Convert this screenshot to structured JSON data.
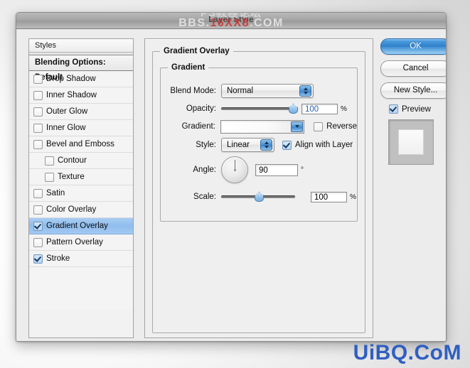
{
  "window": {
    "title": "Layer Style"
  },
  "watermarks": {
    "top_line1": "PS教程论坛",
    "top_line2_prefix": "BBS.",
    "top_line2_red": "16XX8",
    "top_line2_suffix": ".COM",
    "bottom": "UiBQ.CoM",
    "bottom_color": "#2f5fc0"
  },
  "styles_panel": {
    "header": "Styles",
    "blending_options": "Blending Options: Default",
    "items": [
      {
        "label": "Drop Shadow",
        "checked": false,
        "indent": false,
        "selected": false
      },
      {
        "label": "Inner Shadow",
        "checked": false,
        "indent": false,
        "selected": false
      },
      {
        "label": "Outer Glow",
        "checked": false,
        "indent": false,
        "selected": false
      },
      {
        "label": "Inner Glow",
        "checked": false,
        "indent": false,
        "selected": false
      },
      {
        "label": "Bevel and Emboss",
        "checked": false,
        "indent": false,
        "selected": false
      },
      {
        "label": "Contour",
        "checked": false,
        "indent": true,
        "selected": false
      },
      {
        "label": "Texture",
        "checked": false,
        "indent": true,
        "selected": false
      },
      {
        "label": "Satin",
        "checked": false,
        "indent": false,
        "selected": false
      },
      {
        "label": "Color Overlay",
        "checked": false,
        "indent": false,
        "selected": false
      },
      {
        "label": "Gradient Overlay",
        "checked": true,
        "indent": false,
        "selected": true
      },
      {
        "label": "Pattern Overlay",
        "checked": false,
        "indent": false,
        "selected": false
      },
      {
        "label": "Stroke",
        "checked": true,
        "indent": false,
        "selected": false
      }
    ],
    "selection_color": "#8fbdee"
  },
  "settings": {
    "group_title": "Gradient Overlay",
    "subgroup_title": "Gradient",
    "blend_mode": {
      "label": "Blend Mode:",
      "value": "Normal"
    },
    "opacity": {
      "label": "Opacity:",
      "value": "100",
      "unit": "%",
      "slider_percent": 100
    },
    "gradient": {
      "label": "Gradient:",
      "reverse_label": "Reverse",
      "reverse_checked": false
    },
    "style": {
      "label": "Style:",
      "value": "Linear",
      "align_label": "Align with Layer",
      "align_checked": true
    },
    "angle": {
      "label": "Angle:",
      "value": "90",
      "unit": "°"
    },
    "scale": {
      "label": "Scale:",
      "value": "100",
      "unit": "%",
      "slider_percent": 50
    }
  },
  "buttons": {
    "ok": "OK",
    "cancel": "Cancel",
    "new_style": "New Style...",
    "preview_label": "Preview",
    "preview_checked": true,
    "default_button_color": "#2f7fc9"
  }
}
